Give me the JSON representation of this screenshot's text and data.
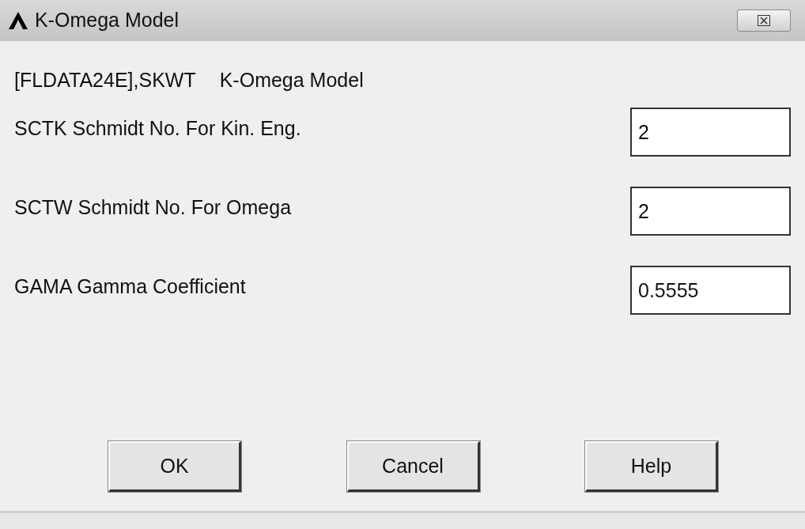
{
  "window": {
    "title": "K-Omega Model"
  },
  "header": {
    "command": "[FLDATA24E],SKWT",
    "label": "K-Omega Model"
  },
  "fields": [
    {
      "label": "SCTK  Schmidt No. For Kin. Eng.",
      "value": "2"
    },
    {
      "label": "SCTW  Schmidt No. For Omega",
      "value": "2"
    },
    {
      "label": "GAMA  Gamma Coefficient",
      "value": "0.5555"
    }
  ],
  "buttons": [
    "OK",
    "Cancel",
    "Help"
  ]
}
